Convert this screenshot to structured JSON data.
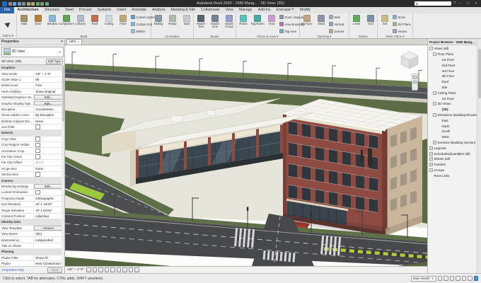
{
  "titlebar": {
    "title": "Autodesk Revit 2020 - 1580 Maug... - 3D View: {3D}",
    "qat_icons": [
      {
        "name": "revit-menu-icon",
        "cls": "q-logo"
      },
      {
        "name": "save-icon",
        "cls": "q-a"
      },
      {
        "name": "undo-icon",
        "cls": "q-b"
      },
      {
        "name": "redo-icon",
        "cls": "q-b"
      },
      {
        "name": "print-icon",
        "cls": "q-a"
      },
      {
        "name": "measure-icon",
        "cls": "q-c"
      },
      {
        "name": "tag-icon",
        "cls": "q-c"
      },
      {
        "name": "default-3d-view-icon",
        "cls": "q-d"
      },
      {
        "name": "section-icon",
        "cls": "q-a"
      },
      {
        "name": "sync-icon",
        "cls": "q-d"
      }
    ],
    "help": "?",
    "window_buttons": {
      "minimize": "–",
      "maximize": "□",
      "close": "×"
    }
  },
  "tabs": [
    {
      "label": "File",
      "cls": "file"
    },
    {
      "label": "Architecture",
      "cls": "active"
    },
    {
      "label": "Structure",
      "cls": ""
    },
    {
      "label": "Steel",
      "cls": ""
    },
    {
      "label": "Precast",
      "cls": ""
    },
    {
      "label": "Systems",
      "cls": ""
    },
    {
      "label": "Insert",
      "cls": ""
    },
    {
      "label": "Annotate",
      "cls": ""
    },
    {
      "label": "Analyze",
      "cls": ""
    },
    {
      "label": "Massing & Site",
      "cls": ""
    },
    {
      "label": "Collaborate",
      "cls": ""
    },
    {
      "label": "View",
      "cls": ""
    },
    {
      "label": "Manage",
      "cls": ""
    },
    {
      "label": "Add-Ins",
      "cls": ""
    },
    {
      "label": "Enscape™",
      "cls": ""
    },
    {
      "label": "Modify",
      "cls": ""
    }
  ],
  "ribbon": {
    "select_label": "Select ▾",
    "panels": [
      {
        "label": "Build",
        "tools": [
          {
            "label": "Wall",
            "cls": "big",
            "icls": "ic-wall"
          },
          {
            "label": "Door",
            "cls": "big",
            "icls": "ic-door"
          },
          {
            "label": "Window",
            "cls": "big",
            "icls": "ic-window"
          },
          {
            "label": "Component",
            "cls": "big",
            "icls": "ic-component"
          },
          {
            "label": "Column",
            "cls": "big",
            "icls": "ic-column"
          },
          {
            "label": "Roof",
            "cls": "big",
            "icls": "ic-roof"
          },
          {
            "label": "Ceiling",
            "cls": "big",
            "icls": "ic-ceiling"
          },
          {
            "label": "Floor",
            "cls": "big",
            "icls": "ic-floor"
          },
          {
            "label": "Curtain System",
            "cls": "small",
            "icls": "ic-curtain-system"
          },
          {
            "label": "Curtain Grid",
            "cls": "small",
            "icls": "ic-curtain-grid"
          },
          {
            "label": "Mullion",
            "cls": "small",
            "icls": "ic-mullion"
          }
        ]
      },
      {
        "label": "Circulation",
        "tools": [
          {
            "label": "Railing",
            "cls": "big",
            "icls": "ic-railing"
          },
          {
            "label": "Ramp",
            "cls": "big",
            "icls": "ic-ramp"
          },
          {
            "label": "Stair",
            "cls": "big",
            "icls": "ic-stair"
          }
        ]
      },
      {
        "label": "Model",
        "tools": [
          {
            "label": "Model Text",
            "cls": "big",
            "icls": "ic-model-text"
          },
          {
            "label": "Model Line",
            "cls": "big",
            "icls": "ic-model-line"
          },
          {
            "label": "Model Group",
            "cls": "big",
            "icls": "ic-model-group"
          }
        ]
      },
      {
        "label": "Room & Area ▾",
        "tools": [
          {
            "label": "Room",
            "cls": "big",
            "icls": "ic-room"
          },
          {
            "label": "Tag Room",
            "cls": "big",
            "icls": "ic-tag-room"
          },
          {
            "label": "Area",
            "cls": "big",
            "icls": "ic-area"
          },
          {
            "label": "Room Separator",
            "cls": "small",
            "icls": "ic-room-separator"
          },
          {
            "label": "Area Boundary",
            "cls": "small",
            "icls": "ic-area-boundary"
          },
          {
            "label": "Tag Area",
            "cls": "small",
            "icls": "ic-tag-area"
          }
        ]
      },
      {
        "label": "Opening ▾",
        "tools": [
          {
            "label": "By Face",
            "cls": "big",
            "icls": "ic-by-face"
          },
          {
            "label": "Shaft",
            "cls": "big",
            "icls": "ic-shaft"
          },
          {
            "label": "Wall",
            "cls": "small",
            "icls": "ic-opening-wall"
          },
          {
            "label": "Vertical",
            "cls": "small",
            "icls": "ic-vertical"
          },
          {
            "label": "Dormer",
            "cls": "small",
            "icls": "ic-dormer"
          }
        ]
      },
      {
        "label": "Datum",
        "tools": [
          {
            "label": "Level",
            "cls": "big",
            "icls": "ic-level"
          },
          {
            "label": "Grid",
            "cls": "big",
            "icls": "ic-grid"
          }
        ]
      },
      {
        "label": "Work Plane ▾",
        "tools": [
          {
            "label": "Set",
            "cls": "big",
            "icls": "ic-set"
          },
          {
            "label": "Show",
            "cls": "small",
            "icls": "ic-show"
          },
          {
            "label": "Ref Plane",
            "cls": "small",
            "icls": "ic-ref-plane"
          },
          {
            "label": "Viewer",
            "cls": "small",
            "icls": "ic-viewer"
          }
        ]
      }
    ]
  },
  "properties": {
    "title": "Properties",
    "close": "×",
    "type_selector": "3D View",
    "instance": "3D View: {3D}",
    "edit_type": "Edit Type",
    "rows": [
      {
        "label": "Graphics",
        "value": "",
        "cls": "hdr",
        "vcls": ""
      },
      {
        "label": "View Scale",
        "value": "1/8\" = 1'-0\"",
        "cls": "",
        "vcls": ""
      },
      {
        "label": "Scale Value    1:",
        "value": "96",
        "cls": "",
        "vcls": ""
      },
      {
        "label": "Detail Level",
        "value": "Fine",
        "cls": "",
        "vcls": ""
      },
      {
        "label": "Parts Visibility",
        "value": "Show Original",
        "cls": "",
        "vcls": ""
      },
      {
        "label": "Visibility/Graphics Ov...",
        "value": "Edit...",
        "cls": "",
        "vcls": "k-edit"
      },
      {
        "label": "Graphic Display Opti...",
        "value": "Edit...",
        "cls": "",
        "vcls": "k-edit"
      },
      {
        "label": "Discipline",
        "value": "Coordination",
        "cls": "",
        "vcls": ""
      },
      {
        "label": "Show Hidden Lines",
        "value": "By Discipline",
        "cls": "",
        "vcls": ""
      },
      {
        "label": "Default Analysis Dis...",
        "value": "None",
        "cls": "",
        "vcls": ""
      },
      {
        "label": "Sun Path",
        "value": "",
        "cls": "",
        "vcls": "k-check"
      },
      {
        "label": "Extents",
        "value": "",
        "cls": "hdr",
        "vcls": ""
      },
      {
        "label": "Crop View",
        "value": "",
        "cls": "",
        "vcls": "k-check"
      },
      {
        "label": "Crop Region Visible",
        "value": "",
        "cls": "",
        "vcls": "k-check"
      },
      {
        "label": "Annotation Crop",
        "value": "",
        "cls": "",
        "vcls": "k-check"
      },
      {
        "label": "Far Clip Active",
        "value": "",
        "cls": "",
        "vcls": "k-check"
      },
      {
        "label": "Far Clip Offset",
        "value": "304.8",
        "cls": "",
        "vcls": "k-dim"
      },
      {
        "label": "Scope Box",
        "value": "None",
        "cls": "",
        "vcls": ""
      },
      {
        "label": "Section Box",
        "value": "",
        "cls": "",
        "vcls": "k-check"
      },
      {
        "label": "Camera",
        "value": "",
        "cls": "hdr",
        "vcls": ""
      },
      {
        "label": "Rendering Settings",
        "value": "Edit...",
        "cls": "",
        "vcls": "k-edit"
      },
      {
        "label": "Locked Orientation",
        "value": "",
        "cls": "",
        "vcls": "k-check"
      },
      {
        "label": "Projection Mode",
        "value": "Orthographic",
        "cls": "",
        "vcls": ""
      },
      {
        "label": "Eye Elevation",
        "value": "20' 1 15/16\"",
        "cls": "",
        "vcls": ""
      },
      {
        "label": "Target Elevation",
        "value": "20' 1 61/64\"",
        "cls": "",
        "vcls": ""
      },
      {
        "label": "Camera Position",
        "value": "Adjusting",
        "cls": "",
        "vcls": ""
      },
      {
        "label": "Identity Data",
        "value": "",
        "cls": "hdr",
        "vcls": ""
      },
      {
        "label": "View Template",
        "value": "<None>",
        "cls": "",
        "vcls": "k-edit"
      },
      {
        "label": "View Name",
        "value": "{3D}",
        "cls": "",
        "vcls": ""
      },
      {
        "label": "Dependency",
        "value": "Independent",
        "cls": "",
        "vcls": ""
      },
      {
        "label": "Title on Sheet",
        "value": "",
        "cls": "",
        "vcls": ""
      },
      {
        "label": "Phasing",
        "value": "",
        "cls": "hdr",
        "vcls": ""
      },
      {
        "label": "Phase Filter",
        "value": "Show All",
        "cls": "",
        "vcls": ""
      },
      {
        "label": "Phase",
        "value": "New Construction",
        "cls": "",
        "vcls": ""
      }
    ],
    "help": "Properties help",
    "apply": "Apply"
  },
  "browser": {
    "title": "Project Browser - 1580 Maug...",
    "items": [
      {
        "label": "Views (all)",
        "tog": "−",
        "cls": "i0"
      },
      {
        "label": "Floor Plans",
        "tog": "−",
        "cls": "i1"
      },
      {
        "label": "1st Floor",
        "tog": "",
        "cls": "i2"
      },
      {
        "label": "2nd Floor",
        "tog": "",
        "cls": "i2"
      },
      {
        "label": "3rd Floor",
        "tog": "",
        "cls": "i2"
      },
      {
        "label": "4th Floor",
        "tog": "",
        "cls": "i2"
      },
      {
        "label": "Roof",
        "tog": "",
        "cls": "i2"
      },
      {
        "label": "Site",
        "tog": "",
        "cls": "i2"
      },
      {
        "label": "Ceiling Plans",
        "tog": "−",
        "cls": "i1"
      },
      {
        "label": "1st Floor",
        "tog": "",
        "cls": "i2"
      },
      {
        "label": "3D Views",
        "tog": "−",
        "cls": "i1"
      },
      {
        "label": "{3D}",
        "tog": "",
        "cls": "i2 active"
      },
      {
        "label": "Elevations (Building Elevation)",
        "tog": "−",
        "cls": "i1"
      },
      {
        "label": "East",
        "tog": "",
        "cls": "i2"
      },
      {
        "label": "North",
        "tog": "",
        "cls": "i2"
      },
      {
        "label": "South",
        "tog": "",
        "cls": "i2"
      },
      {
        "label": "West",
        "tog": "",
        "cls": "i2"
      },
      {
        "label": "Sections (Building Section)",
        "tog": "+",
        "cls": "i1"
      },
      {
        "label": "Legends",
        "tog": "+",
        "cls": "i0"
      },
      {
        "label": "Schedules/Quantities (all)",
        "tog": "+",
        "cls": "i0"
      },
      {
        "label": "Sheets (all)",
        "tog": "+",
        "cls": "i0"
      },
      {
        "label": "Families",
        "tog": "+",
        "cls": "i0"
      },
      {
        "label": "Groups",
        "tog": "+",
        "cls": "i0"
      },
      {
        "label": "Revit Links",
        "tog": "",
        "cls": "i0"
      }
    ]
  },
  "viewport": {
    "tab": "{3D}",
    "tab_close": "×",
    "scale": "1/8\" = 1'-0\"",
    "controls": [
      {
        "name": "detail-level-icon"
      },
      {
        "name": "visual-style-icon"
      },
      {
        "name": "sun-path-icon"
      },
      {
        "name": "shadows-icon"
      },
      {
        "name": "render-icon"
      },
      {
        "name": "crop-view-icon"
      },
      {
        "name": "show-crop-icon"
      },
      {
        "name": "temporary-hide-icon"
      },
      {
        "name": "reveal-hidden-icon"
      }
    ]
  },
  "statusbar": {
    "hint": "Click to select, TAB for alternates, CTRL adds, SHIFT unselects.",
    "workset": "Main Model",
    "icons": [
      {
        "name": "worksets-icon"
      },
      {
        "name": "design-options-icon"
      },
      {
        "name": "editable-only-icon"
      },
      {
        "name": "select-links-icon"
      },
      {
        "name": "select-pinned-icon"
      },
      {
        "name": "drag-on-selection-icon"
      },
      {
        "name": "filter-icon",
        "cls": "filter-blue"
      }
    ]
  },
  "colors": {
    "titlebar": "#2b2b2b",
    "ribbon": "#ececec",
    "road": "#46484c",
    "grass": "#5c6d45",
    "brick": "#8d4b43",
    "roof_white": "#f5f3ed",
    "accent_blue": "#2e66ac"
  }
}
